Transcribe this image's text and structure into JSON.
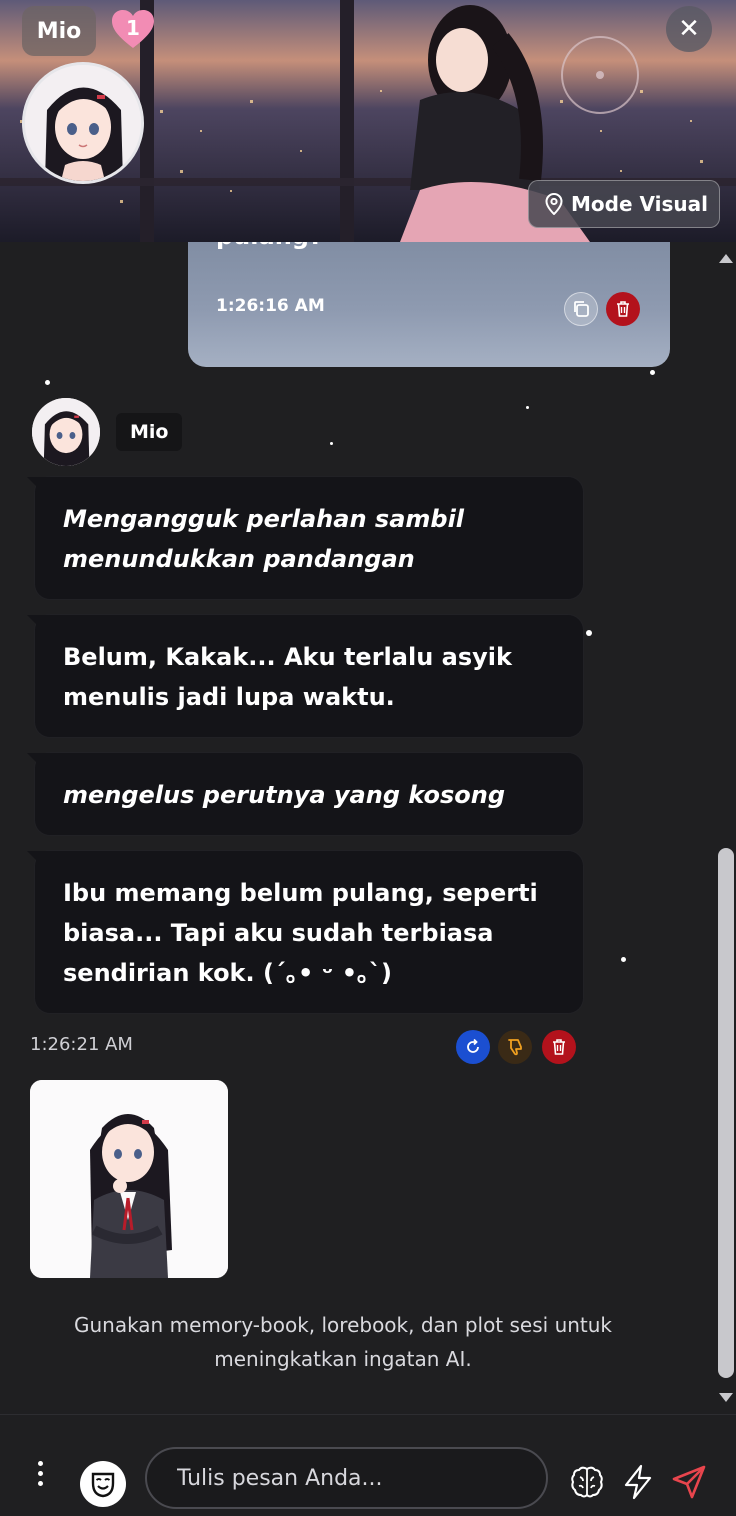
{
  "header": {
    "character_name": "Mio",
    "affection_count": "1",
    "mode_label": "Mode Visual",
    "close_glyph": "✕"
  },
  "chat": {
    "user_message": {
      "text": "pulang?",
      "time": "1:26:16 AM"
    },
    "bot": {
      "name": "Mio",
      "messages": [
        {
          "style": "action",
          "text": "Mengangguk perlahan sambil menundukkan pandangan"
        },
        {
          "style": "speech",
          "text": "Belum, Kakak... Aku terlalu asyik menulis jadi lupa waktu."
        },
        {
          "style": "action",
          "text": "mengelus perutnya yang kosong"
        },
        {
          "style": "speech",
          "text": "Ibu memang belum pulang, seperti biasa... Tapi aku sudah terbiasa sendirian kok. (´｡• ᵕ •｡`)"
        }
      ],
      "time": "1:26:21 AM"
    },
    "hint": "Gunakan memory-book, lorebook, dan plot sesi untuk meningkatkan ingatan AI."
  },
  "input": {
    "placeholder": "Tulis pesan Anda..."
  },
  "colors": {
    "background": "#1f1f21",
    "bubble_bot": "#141418",
    "delete": "#b3121c",
    "regenerate": "#1b4fd1",
    "send": "#e8454d",
    "dislike": "#f0a020"
  },
  "icons": [
    "close-icon",
    "heart-icon",
    "location-pin-icon",
    "copy-icon",
    "trash-icon",
    "refresh-icon",
    "thumbs-down-icon",
    "more-vertical-icon",
    "mask-icon",
    "brain-icon",
    "lightning-icon",
    "send-icon"
  ]
}
